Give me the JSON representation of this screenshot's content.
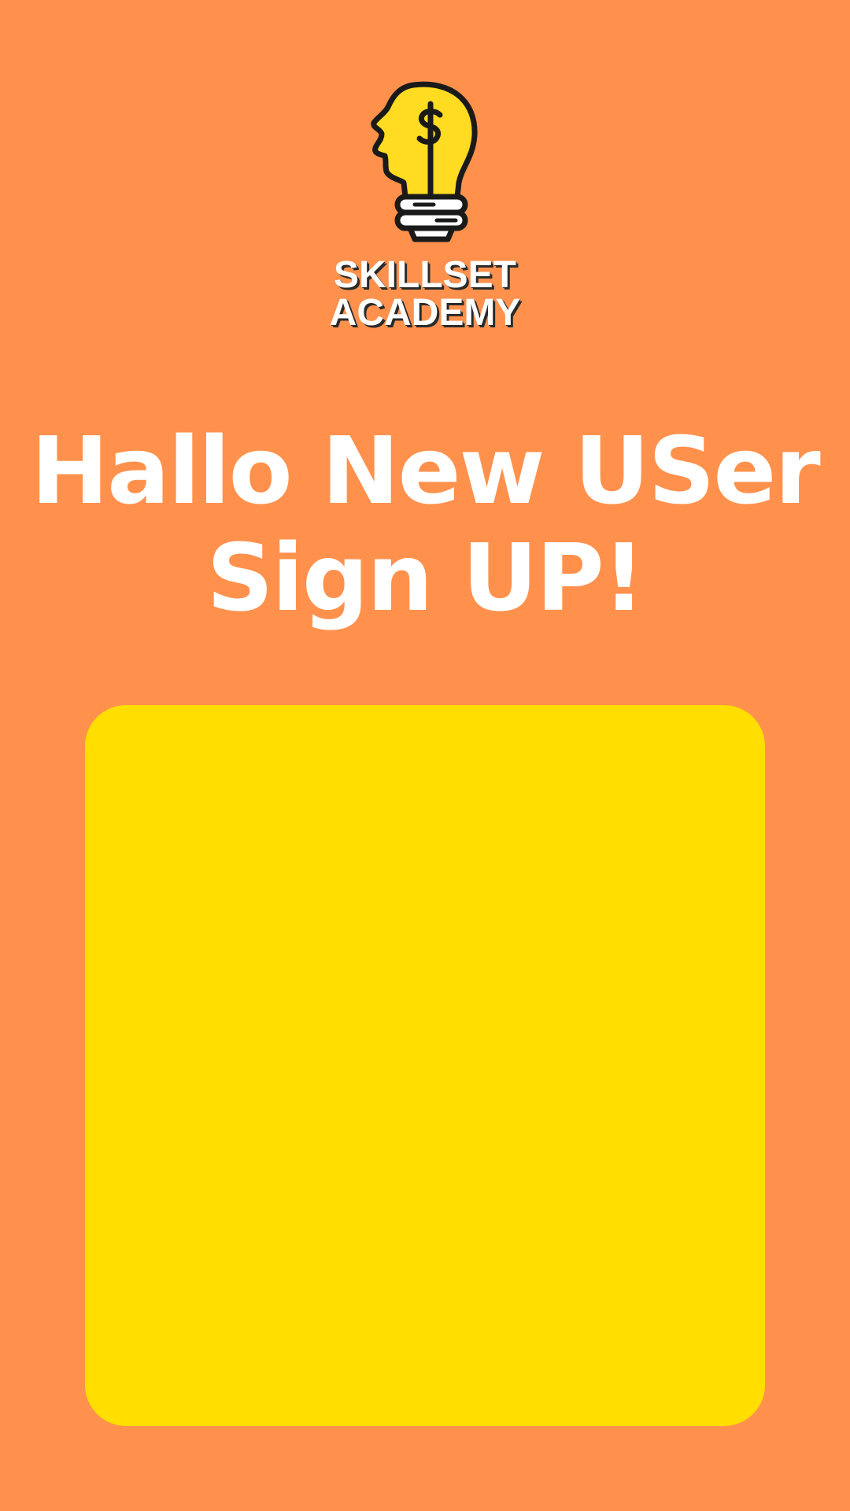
{
  "brand": {
    "line1": "SKILLSET",
    "line2": "ACADEMY",
    "icon": "lightbulb-head-dollar-icon"
  },
  "headline": {
    "line1": "Hallo New USer",
    "line2": "Sign UP!"
  },
  "colors": {
    "background": "#FF914D",
    "panel": "#FFDE00",
    "text": "#FFFFFF"
  }
}
